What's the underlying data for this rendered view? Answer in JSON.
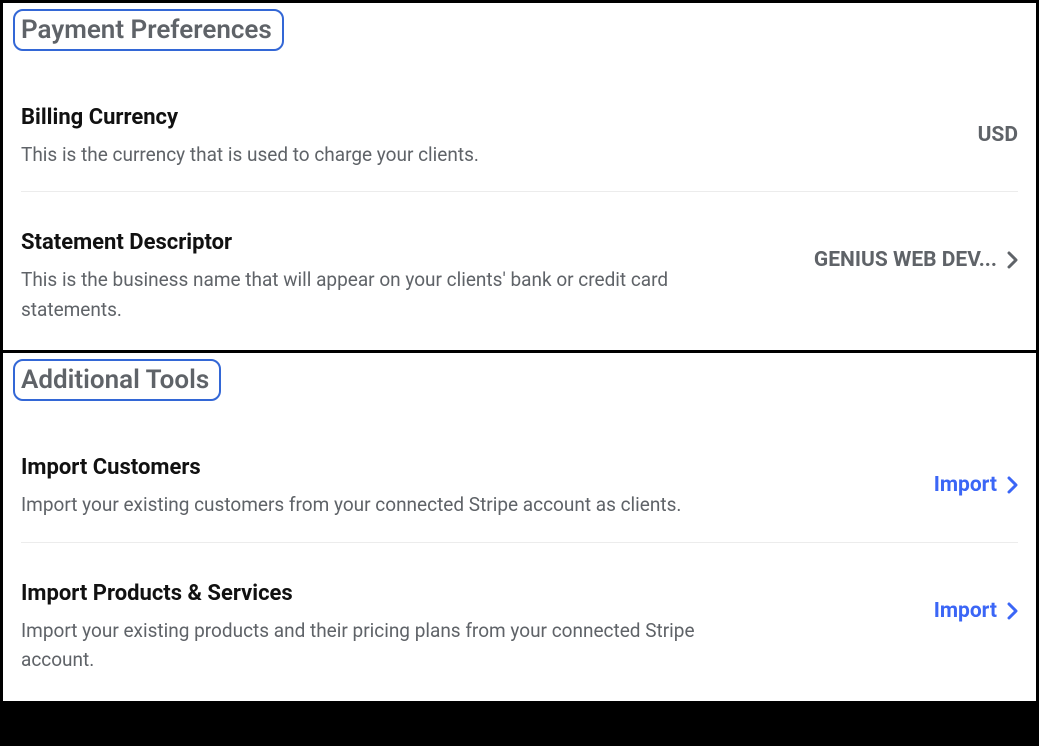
{
  "sections": {
    "payment": {
      "title": "Payment Preferences",
      "billing_currency": {
        "title": "Billing Currency",
        "desc": "This is the currency that is used to charge your clients.",
        "value": "USD"
      },
      "statement_descriptor": {
        "title": "Statement Descriptor",
        "desc": "This is the business name that will appear on your clients' bank or credit card statements.",
        "value": "GENIUS WEB DEV..."
      }
    },
    "tools": {
      "title": "Additional Tools",
      "import_customers": {
        "title": "Import Customers",
        "desc": "Import your existing customers from your connected Stripe account as clients.",
        "action": "Import"
      },
      "import_products": {
        "title": "Import Products & Services",
        "desc": "Import your existing products and their pricing plans from your connected Stripe account.",
        "action": "Import"
      }
    }
  }
}
